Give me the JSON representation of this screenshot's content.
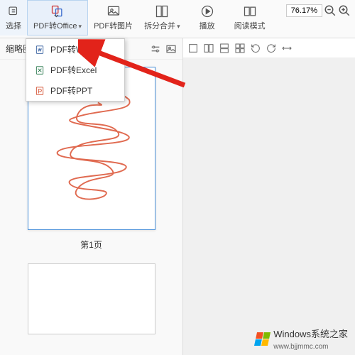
{
  "toolbar": {
    "items": [
      {
        "label": "选择",
        "icon": "cursor-icon"
      },
      {
        "label": "PDF转Office",
        "icon": "pdf-office-icon",
        "dropdown": true,
        "active": true
      },
      {
        "label": "PDF转图片",
        "icon": "pdf-image-icon"
      },
      {
        "label": "拆分合并",
        "icon": "split-merge-icon",
        "dropdown": true
      },
      {
        "label": "播放",
        "icon": "play-icon"
      },
      {
        "label": "阅读模式",
        "icon": "read-mode-icon"
      }
    ],
    "zoom": {
      "percent": "76.17%"
    }
  },
  "secondary_icons": [
    "layout1",
    "layout2",
    "layout3",
    "layout4",
    "layout5",
    "layout6",
    "layout7"
  ],
  "dropdown": {
    "items": [
      {
        "label": "PDF转Word",
        "icon": "word-icon"
      },
      {
        "label": "PDF转Excel",
        "icon": "excel-icon"
      },
      {
        "label": "PDF转PPT",
        "icon": "ppt-icon"
      }
    ]
  },
  "side": {
    "title": "缩略图",
    "page_label": "第1页"
  },
  "watermark": {
    "text": "Windows系统之家",
    "url": "www.bjjmmc.com"
  },
  "colors": {
    "accent": "#4a90d9",
    "arrow": "#e2231a"
  }
}
